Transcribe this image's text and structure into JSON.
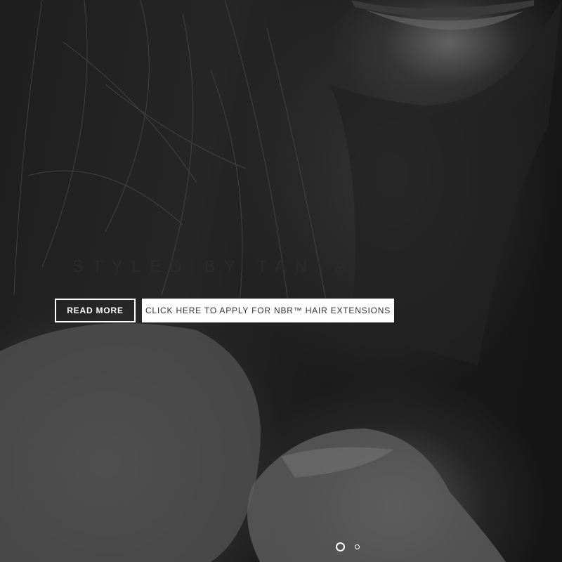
{
  "hero": {
    "title": "STYLED BY TANYA",
    "read_more_label": "READ MORE",
    "apply_label": "CLICK HERE TO APPLY FOR NBR™ HAIR EXTENSIONS"
  },
  "slider": {
    "slide_count": 2,
    "active_slide": 1
  },
  "colors": {
    "background": "#1a1a1a",
    "button_text_dark": "#333333",
    "button_bg_light": "#ffffff",
    "title_text": "#2b2b2b"
  }
}
